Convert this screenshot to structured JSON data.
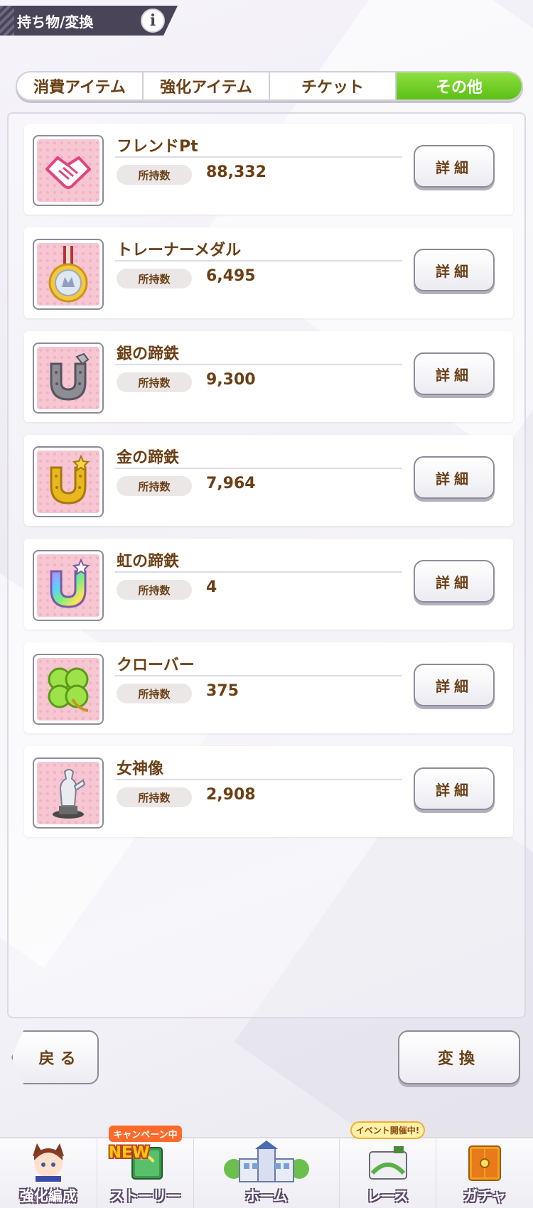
{
  "header": {
    "title": "持ち物/変換",
    "info_icon_char": "i"
  },
  "tabs": [
    {
      "label": "消費アイテム",
      "active": false
    },
    {
      "label": "強化アイテム",
      "active": false
    },
    {
      "label": "チケット",
      "active": false
    },
    {
      "label": "その他",
      "active": true
    }
  ],
  "items": [
    {
      "name": "フレンドPt",
      "count_label": "所持数",
      "count": "88,332",
      "icon": "handshake-icon",
      "detail_label": "詳細"
    },
    {
      "name": "トレーナーメダル",
      "count_label": "所持数",
      "count": "6,495",
      "icon": "medal-icon",
      "detail_label": "詳細"
    },
    {
      "name": "銀の蹄鉄",
      "count_label": "所持数",
      "count": "9,300",
      "icon": "silver-horseshoe-icon",
      "detail_label": "詳細"
    },
    {
      "name": "金の蹄鉄",
      "count_label": "所持数",
      "count": "7,964",
      "icon": "gold-horseshoe-icon",
      "detail_label": "詳細"
    },
    {
      "name": "虹の蹄鉄",
      "count_label": "所持数",
      "count": "4",
      "icon": "rainbow-horseshoe-icon",
      "detail_label": "詳細"
    },
    {
      "name": "クローバー",
      "count_label": "所持数",
      "count": "375",
      "icon": "clover-icon",
      "detail_label": "詳細"
    },
    {
      "name": "女神像",
      "count_label": "所持数",
      "count": "2,908",
      "icon": "goddess-statue-icon",
      "detail_label": "詳細"
    }
  ],
  "footer": {
    "back_label": "戻る",
    "convert_label": "変換"
  },
  "bottom_nav": [
    {
      "label": "強化編成",
      "icon": "character-portrait-icon"
    },
    {
      "label": "ストーリー",
      "icon": "story-book-icon",
      "badge_top": "キャンペーン中",
      "badge_new": "NEW"
    },
    {
      "label": "ホーム",
      "icon": "school-building-icon"
    },
    {
      "label": "レース",
      "icon": "race-track-icon",
      "badge_top": "イベント開催中!"
    },
    {
      "label": "ガチャ",
      "icon": "gacha-door-icon"
    }
  ],
  "colors": {
    "active_tab": "#6cc924",
    "text_brown": "#6b3f14",
    "header_bg": "#4a4458"
  }
}
